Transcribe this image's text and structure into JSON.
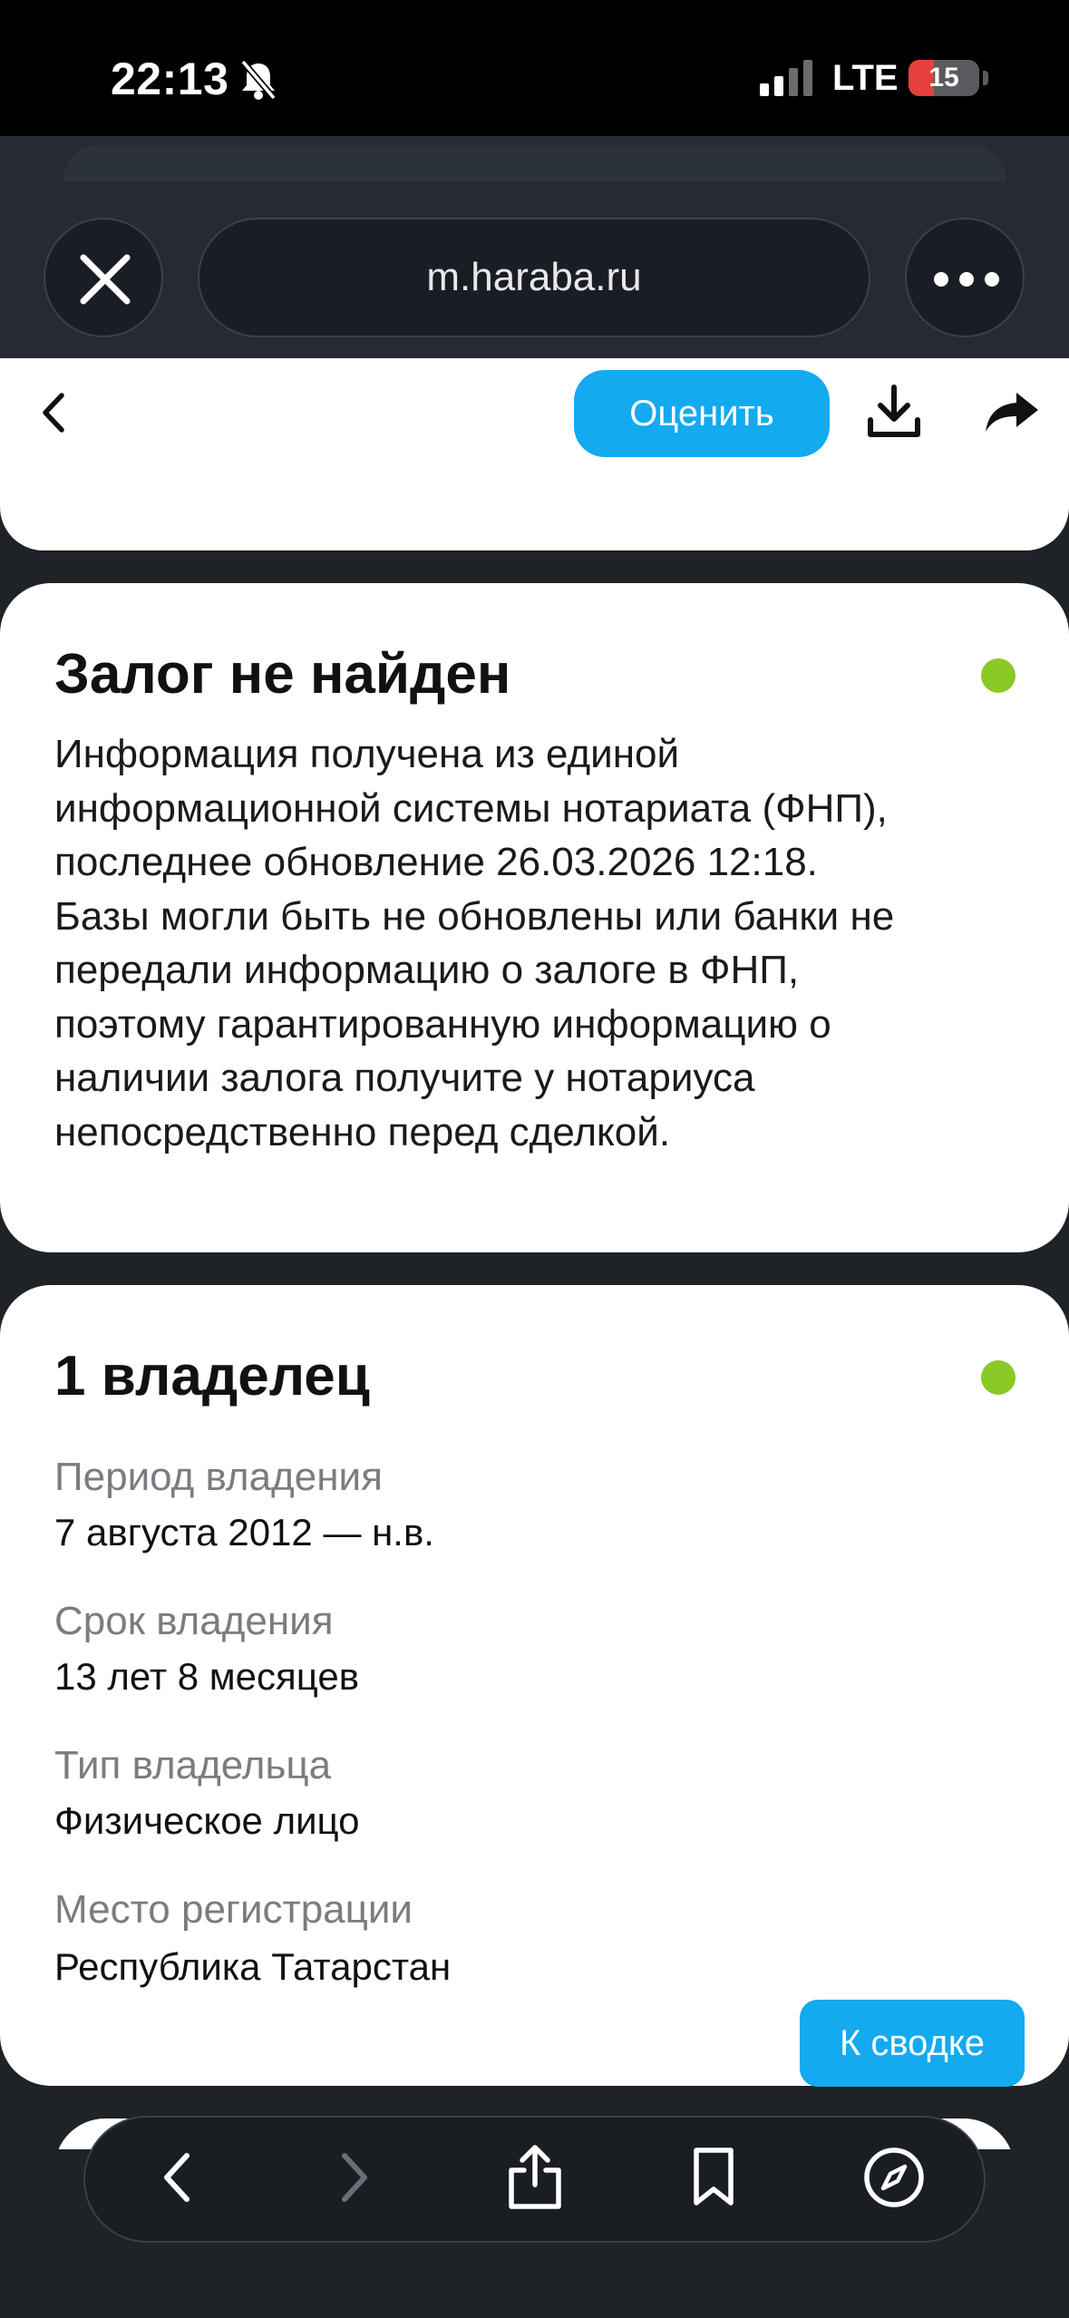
{
  "status_bar": {
    "time": "22:13",
    "network": "LTE",
    "battery": "15",
    "battery_level_percent": 15,
    "battery_color": "#e5403b",
    "icons": [
      "bell-slash-icon",
      "signal-icon",
      "battery-icon"
    ]
  },
  "browser": {
    "url": "m.haraba.ru",
    "close_icon": "close-icon",
    "more_icon": "more-icon"
  },
  "header": {
    "rate_button": "Оценить",
    "icons": [
      "chevron-left-icon",
      "download-icon",
      "share-icon"
    ],
    "accent_color": "#13aaf0"
  },
  "pledge_card": {
    "title": "Залог не найден",
    "status_color": "#8ac926",
    "lines": [
      "Информация получена из единой",
      "информационной системы нотариата (ФНП),",
      "последнее обновление 26.03.2026 12:18.",
      "Базы могли быть не обновлены или банки не",
      "передали информацию о залоге в ФНП,",
      "поэтому гарантированную информацию о",
      "наличии залога получите у нотариуса",
      "непосредственно перед сделкой."
    ]
  },
  "owner_card": {
    "title": "1 владелец",
    "status_color": "#8ac926",
    "fields": [
      {
        "label": "Период владения",
        "value": "7 августа 2012 — н.в."
      },
      {
        "label": "Срок владения",
        "value": "13 лет 8 месяцев"
      },
      {
        "label": "Тип владельца",
        "value": "Физическое лицо"
      },
      {
        "label": "Место регистрации",
        "value": "Республика Татарстан"
      }
    ],
    "summary_button": "К сводке"
  },
  "toolbar": {
    "icons": [
      "back-icon",
      "forward-icon",
      "share-icon",
      "bookmarks-icon",
      "compass-icon"
    ]
  }
}
